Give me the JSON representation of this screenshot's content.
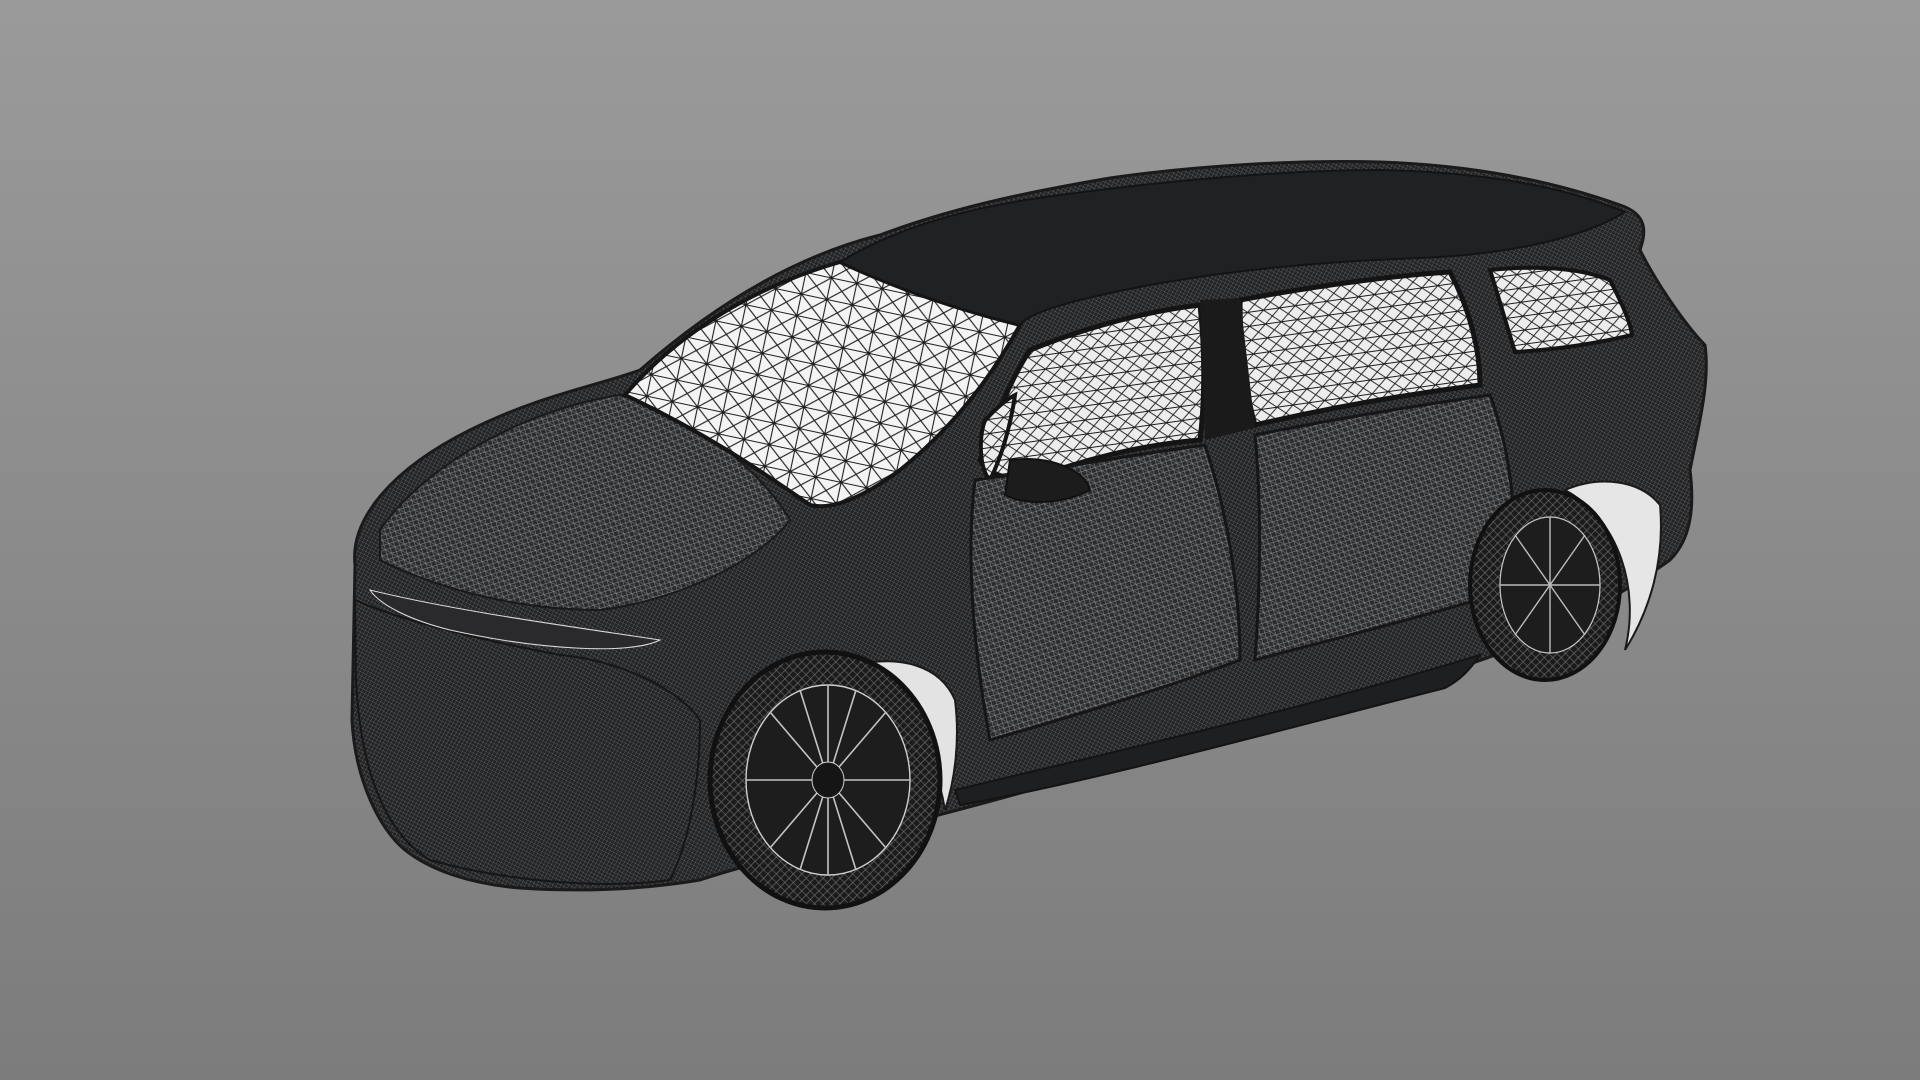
{
  "viewport": {
    "background_top": "#9a9a9a",
    "background_bottom": "#7c7c7c"
  },
  "model": {
    "icon": "wireframe-car-mesh",
    "display_mode": "wireframe",
    "body_color": "#222325",
    "mesh_line_color": "#f2f2f2"
  }
}
